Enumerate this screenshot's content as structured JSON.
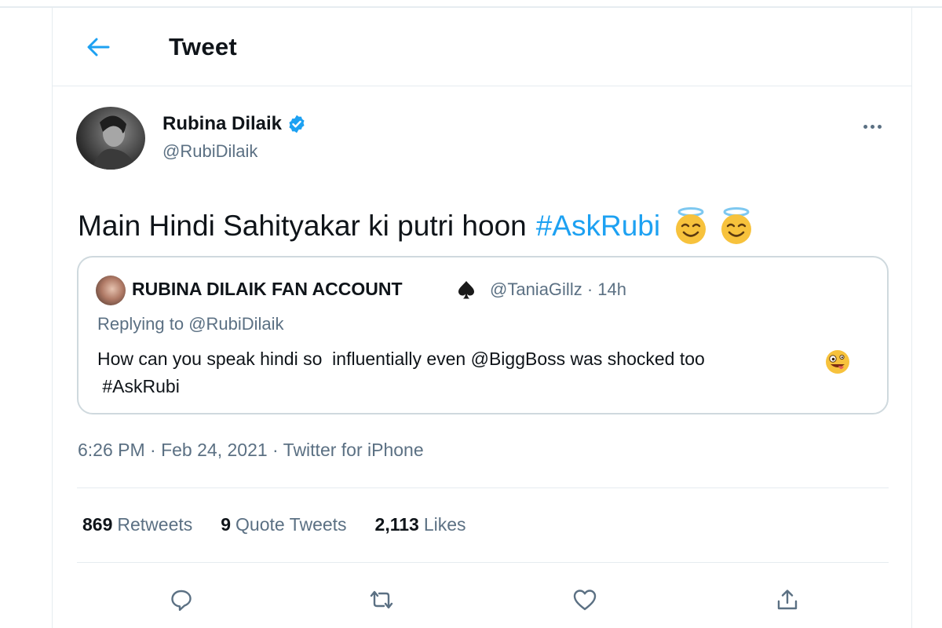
{
  "header": {
    "title": "Tweet",
    "back_icon": "back-arrow-icon",
    "accent": "#1da1f2"
  },
  "tweet": {
    "author_name": "Rubina Dilaik",
    "author_handle": "@RubiDilaik",
    "text": "Main Hindi Sahityakar ki putri hoon",
    "hashtag": "#AskRubi",
    "emojis": [
      "smiling-face-with-halo",
      "smiling-face-with-halo"
    ],
    "timestamp": "6:26 PM · Feb 24, 2021 · ",
    "source": "Twitter for iPhone"
  },
  "quote": {
    "author_name": "RUBINA DILAIK FAN ACCOUNT",
    "author_handle_time": "@TaniaGillz · 14h",
    "replying_prefix": "Replying to ",
    "replying_to": "@RubiDilaik",
    "text": "How can you speak hindi so  influentially even @BiggBoss was shocked too      \n #AskRubi"
  },
  "stats": {
    "retweets_count": "869",
    "retweets_label": "Retweets",
    "quotes_count": "9",
    "quotes_label": "Quote Tweets",
    "likes_count": "2,113",
    "likes_label": "Likes"
  },
  "colors": {
    "text": "#0f1419",
    "secondary": "#5b7083",
    "border": "#e6ecf0",
    "link": "#1da1f2",
    "verified": "#1da1f2"
  }
}
